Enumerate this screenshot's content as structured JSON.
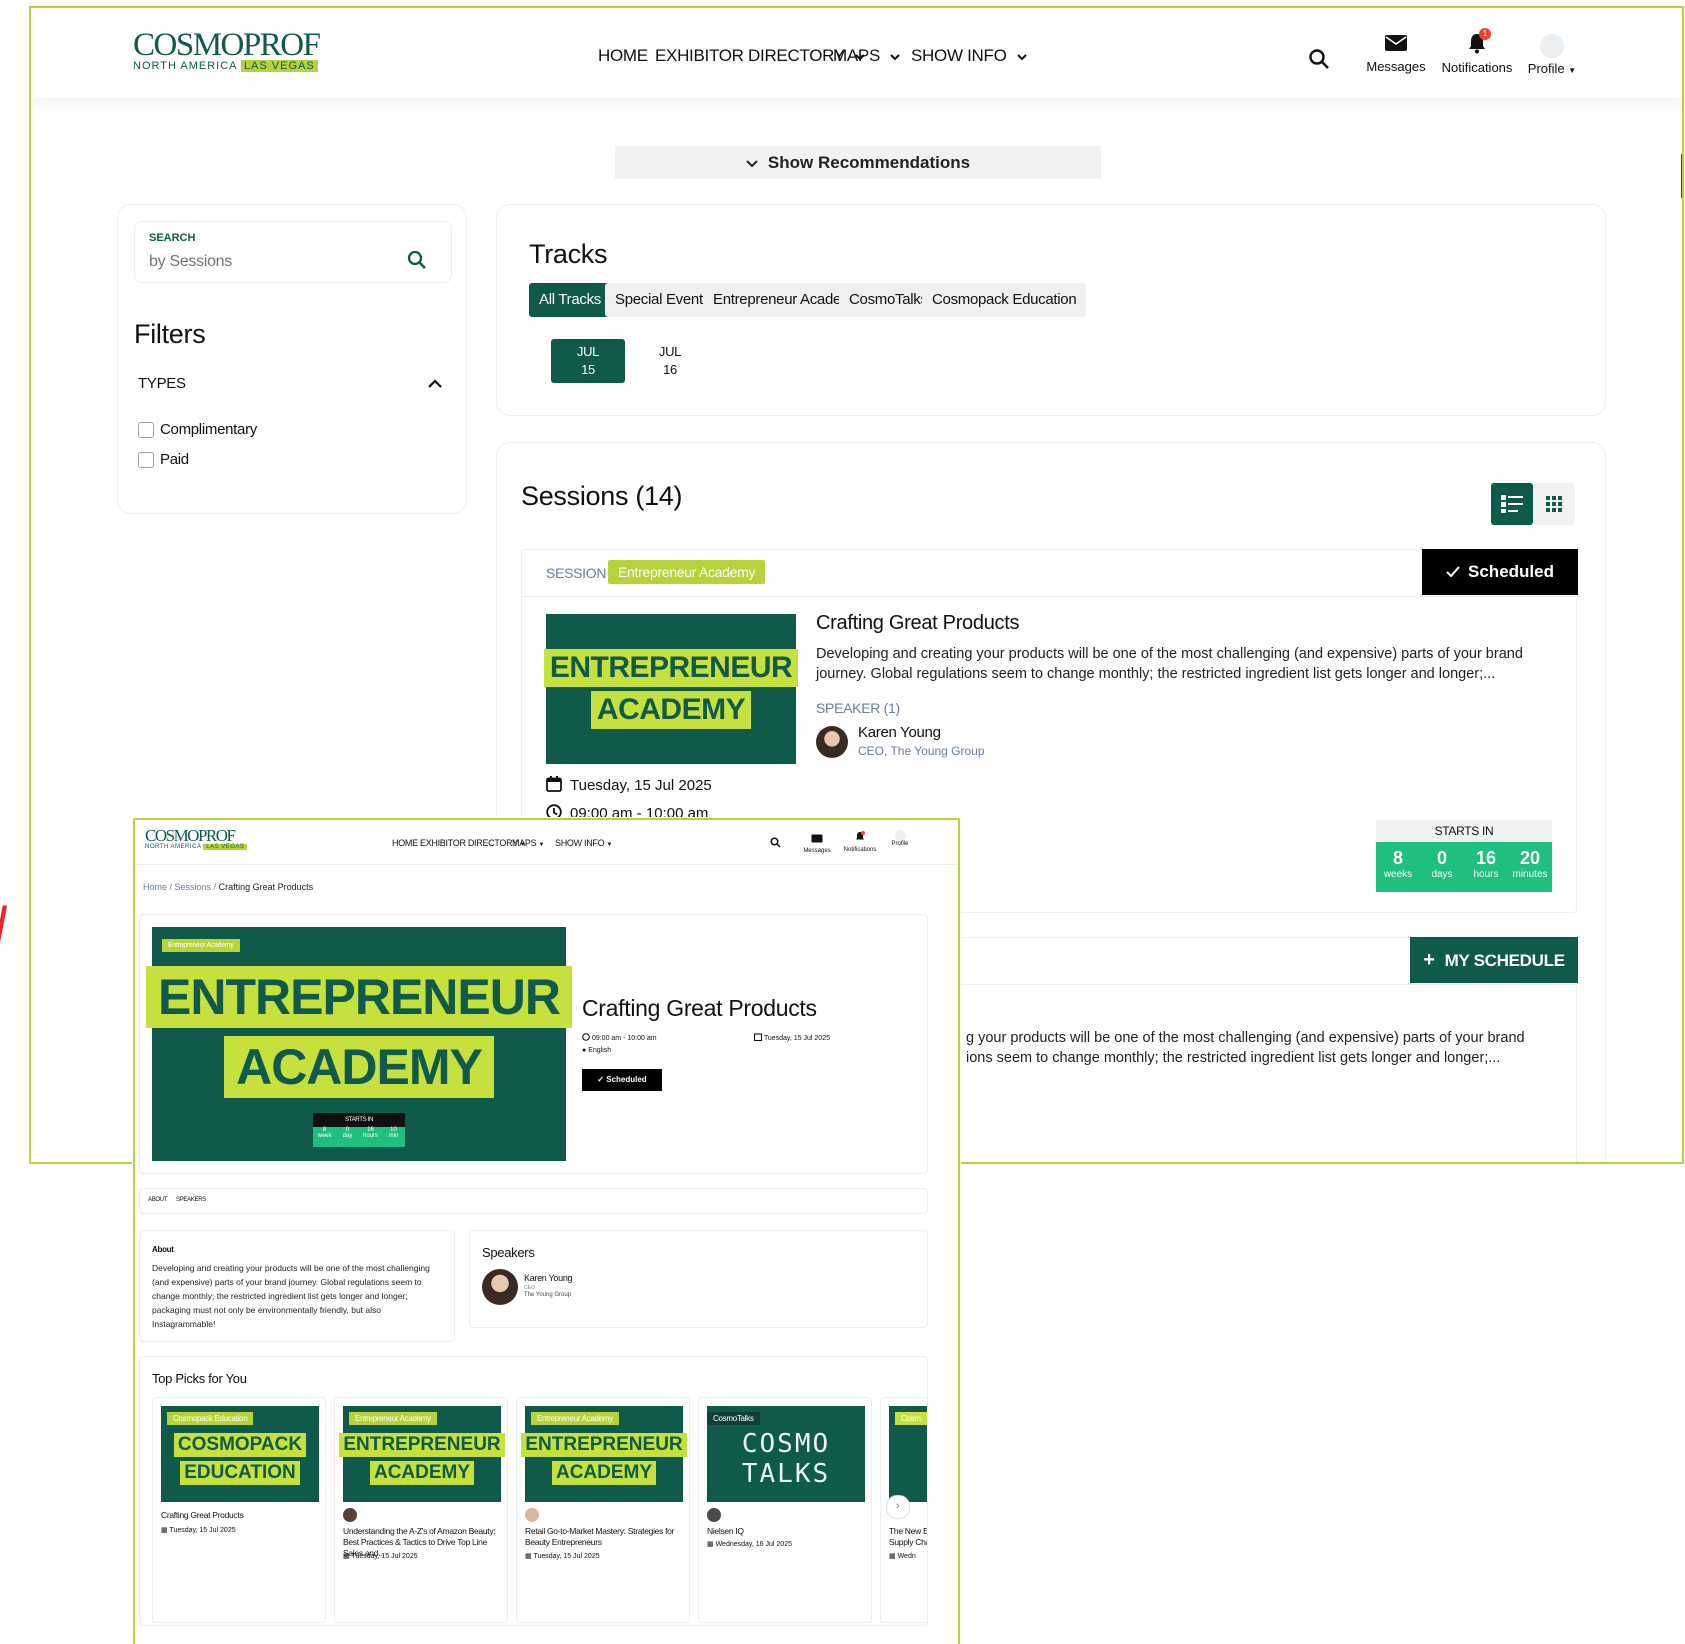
{
  "brand": {
    "name": "COSMOPROF",
    "sub_prefix": "NORTH AMERICA",
    "sub_highlight": "LAS VEGAS"
  },
  "nav": {
    "home": "HOME",
    "exhibitor_directory": "EXHIBITOR DIRECTORY",
    "maps": "MAPS",
    "show_info": "SHOW INFO",
    "messages": "Messages",
    "notifications": "Notifications",
    "notifications_count": "1",
    "profile": "Profile"
  },
  "recommendations": {
    "label": "Show Recommendations"
  },
  "search": {
    "label": "SEARCH",
    "placeholder": "by Sessions"
  },
  "filters": {
    "title": "Filters",
    "types_label": "TYPES",
    "options": [
      {
        "label": "Complimentary",
        "checked": false
      },
      {
        "label": "Paid",
        "checked": false
      }
    ]
  },
  "tracks": {
    "title": "Tracks",
    "items": [
      "All Tracks",
      "Special Events",
      "Entrepreneur Academy",
      "CosmoTalks",
      "Cosmopack Education"
    ],
    "active": "All Tracks",
    "dates": [
      {
        "month": "JUL",
        "day": "15",
        "active": true
      },
      {
        "month": "JUL",
        "day": "16",
        "active": false
      }
    ]
  },
  "sessions": {
    "title": "Sessions (14)",
    "card1": {
      "type_label": "SESSION",
      "track_tag": "Entrepreneur Academy",
      "status": "Scheduled",
      "thumb_line1": "ENTREPRENEUR",
      "thumb_line2": "ACADEMY",
      "title": "Crafting Great Products",
      "description": "Developing and creating your products will be one of the most challenging (and expensive) parts of your brand journey. Global regulations seem to change monthly; the restricted ingredient list gets longer and longer;...",
      "speaker_label": "SPEAKER (1)",
      "speaker_name": "Karen Young",
      "speaker_role": "CEO, The Young Group",
      "date": "Tuesday, 15 Jul 2025",
      "time": "09:00 am - 10:00 am",
      "starts_in_label": "STARTS IN",
      "countdown": [
        {
          "value": "8",
          "unit": "weeks"
        },
        {
          "value": "0",
          "unit": "days"
        },
        {
          "value": "16",
          "unit": "hours"
        },
        {
          "value": "20",
          "unit": "minutes"
        }
      ]
    },
    "card2": {
      "button": "MY SCHEDULE",
      "description_partial": "g your products will be one of the most challenging (and expensive) parts of your brand\nions seem to change monthly; the restricted ingredient list gets longer and longer;..."
    }
  },
  "overlay": {
    "breadcrumb": {
      "home": "Home",
      "sessions": "Sessions",
      "current": "Crafting Great Products"
    },
    "hero": {
      "tag": "Entrepreneur Academy",
      "line1": "ENTREPRENEUR",
      "line2": "ACADEMY",
      "starts_in": "STARTS IN",
      "countdown": [
        {
          "value": "8",
          "unit": "week"
        },
        {
          "value": "0",
          "unit": "day"
        },
        {
          "value": "16",
          "unit": "hours"
        },
        {
          "value": "10",
          "unit": "min"
        }
      ]
    },
    "title": "Crafting Great Products",
    "time": "09:00 am - 10:00 am",
    "date": "Tuesday, 15 Jul 2025",
    "language": "English",
    "status": "Scheduled",
    "tabs": [
      "ABOUT",
      "SPEAKERS"
    ],
    "about_title": "About",
    "about_text": "Developing and creating your products will be one of the most challenging (and expensive) parts of your brand journey. Global regulations seem to change monthly; the restricted ingredient list gets longer and longer; packaging must not only be environmentally friendly, but also Instagrammable!",
    "speakers_title": "Speakers",
    "speaker_name": "Karen Young",
    "speaker_role": "CEO",
    "speaker_company": "The Young Group",
    "top_picks_title": "Top Picks for You",
    "picks": [
      {
        "tag": "Cosmopack Education",
        "line1": "COSMOPACK",
        "line2": "EDUCATION",
        "title": "Crafting Great Products",
        "date": "Tuesday, 15 Jul 2025"
      },
      {
        "tag": "Entrepreneur Academy",
        "line1": "ENTREPRENEUR",
        "line2": "ACADEMY",
        "title": "Understanding the A-Z's of Amazon Beauty: Best Practices & Tactics to Drive Top Line Sales and...",
        "date": "Tuesday, 15 Jul 2025"
      },
      {
        "tag": "Entrepreneur Academy",
        "line1": "ENTREPRENEUR",
        "line2": "ACADEMY",
        "title": "Retail Go-to-Market Mastery: Strategies for Beauty Entrepreneurs",
        "date": "Tuesday, 15 Jul 2025"
      },
      {
        "tag": "CosmoTalks",
        "line1": "COSMO",
        "line2": "TALKS",
        "title": "Nielsen IQ",
        "date": "Wednesday, 16 Jul 2025"
      },
      {
        "tag": "Cosm",
        "line1": "",
        "line2": "",
        "title": "The New E\nSupply Cha",
        "date": "Wedn"
      }
    ]
  },
  "colors": {
    "brand_green": "#0f5a4a",
    "lime": "#c6e03e",
    "border_lime": "#b6d33a",
    "countdown_green": "#1fbf7e"
  },
  "icons": [
    "search-icon",
    "envelope-icon",
    "bell-icon",
    "avatar-icon",
    "chevron-down-icon",
    "chevron-up-icon",
    "list-view-icon",
    "grid-view-icon",
    "check-icon",
    "calendar-icon",
    "clock-icon",
    "plus-icon",
    "mic-icon"
  ]
}
